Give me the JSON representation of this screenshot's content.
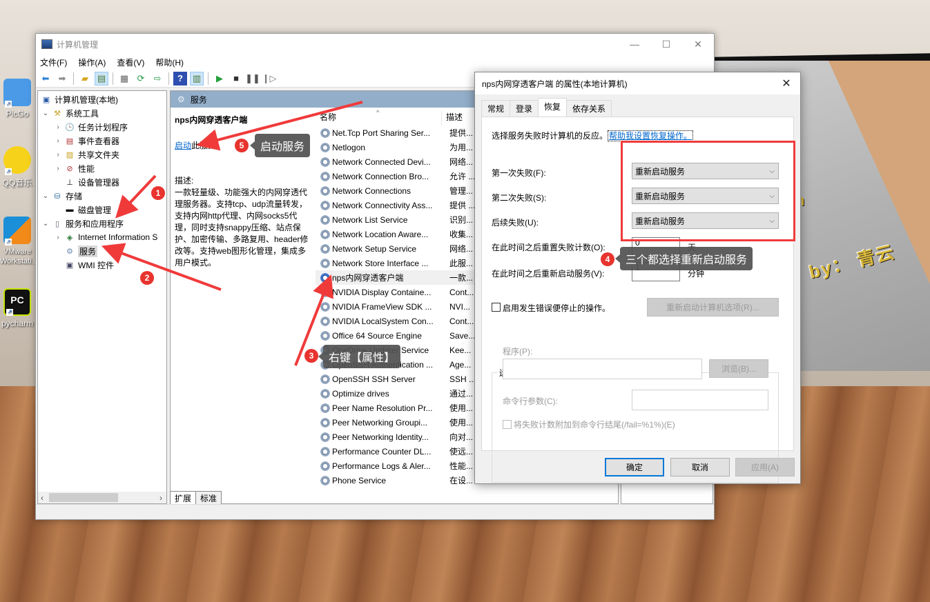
{
  "desktop": {
    "icons": [
      {
        "label": "PicGo",
        "icon": "picgo-icon",
        "color": "#3d8fe6"
      },
      {
        "label": "QQ音乐",
        "icon": "qq-music-icon",
        "color": "#f7d21a"
      },
      {
        "label": "VMware Workstati...",
        "icon": "vmware-icon",
        "color": "#1b8fd8"
      },
      {
        "label": "pycharm",
        "icon": "pycharm-icon",
        "color": "#111111"
      }
    ],
    "wallpaper_text": "by： 青云",
    "wallpaper_letter": "n"
  },
  "mmc": {
    "title": "计算机管理",
    "menu": [
      "文件(F)",
      "操作(A)",
      "查看(V)",
      "帮助(H)"
    ],
    "toolbar": [
      "back-icon",
      "forward-icon",
      "up-folder-icon",
      "show-hide-console-tree-icon",
      "properties-icon",
      "refresh-icon",
      "export-list-icon",
      "help-icon",
      "show-action-pane-icon",
      "start-service-icon",
      "stop-service-icon",
      "pause-service-icon",
      "resume-service-icon"
    ],
    "tree": [
      {
        "label": "计算机管理(本地)",
        "level": 0,
        "chevron": "",
        "icon": "computer-management-icon"
      },
      {
        "label": "系统工具",
        "level": 1,
        "chevron": "⌄",
        "icon": "system-tools-icon"
      },
      {
        "label": "任务计划程序",
        "level": 2,
        "chevron": "›",
        "icon": "task-scheduler-icon"
      },
      {
        "label": "事件查看器",
        "level": 2,
        "chevron": "›",
        "icon": "event-viewer-icon"
      },
      {
        "label": "共享文件夹",
        "level": 2,
        "chevron": "›",
        "icon": "shared-folders-icon"
      },
      {
        "label": "性能",
        "level": 2,
        "chevron": "›",
        "icon": "performance-icon"
      },
      {
        "label": "设备管理器",
        "level": 2,
        "chevron": "",
        "icon": "device-manager-icon"
      },
      {
        "label": "存储",
        "level": 1,
        "chevron": "⌄",
        "icon": "storage-icon"
      },
      {
        "label": "磁盘管理",
        "level": 2,
        "chevron": "",
        "icon": "disk-management-icon"
      },
      {
        "label": "服务和应用程序",
        "level": 1,
        "chevron": "⌄",
        "icon": "services-apps-icon"
      },
      {
        "label": "Internet Information S",
        "level": 2,
        "chevron": "›",
        "icon": "iis-icon"
      },
      {
        "label": "服务",
        "level": 2,
        "chevron": "",
        "icon": "services-icon",
        "selected": true
      },
      {
        "label": "WMI 控件",
        "level": 2,
        "chevron": "",
        "icon": "wmi-icon"
      }
    ],
    "center_header": "服务",
    "detail": {
      "service_name": "nps内网穿透客户端",
      "start_link": "启动",
      "start_suffix": "此服务",
      "desc_label": "描述:",
      "description": "一款轻量级、功能强大的内网穿透代理服务器。支持tcp、udp流量转发，支持内网http代理、内网socks5代理，同时支持snappy压缩、站点保护、加密传输、多路复用、header修改等。支持web图形化管理，集成多用户模式。"
    },
    "list": {
      "columns": [
        "名称",
        "描述"
      ],
      "rows": [
        {
          "name": "Net.Tcp Port Sharing Ser...",
          "desc": "提供..."
        },
        {
          "name": "Netlogon",
          "desc": "为用..."
        },
        {
          "name": "Network Connected Devi...",
          "desc": "网络..."
        },
        {
          "name": "Network Connection Bro...",
          "desc": "允许 ..."
        },
        {
          "name": "Network Connections",
          "desc": "管理..."
        },
        {
          "name": "Network Connectivity Ass...",
          "desc": "提供 ..."
        },
        {
          "name": "Network List Service",
          "desc": "识别..."
        },
        {
          "name": "Network Location Aware...",
          "desc": "收集..."
        },
        {
          "name": "Network Setup Service",
          "desc": "网络..."
        },
        {
          "name": "Network Store Interface ...",
          "desc": "此服..."
        },
        {
          "name": "nps内网穿透客户端",
          "desc": "一款...",
          "highlighted": true
        },
        {
          "name": "NVIDIA Display Containe...",
          "desc": "Cont..."
        },
        {
          "name": "NVIDIA FrameView SDK ...",
          "desc": "NVI..."
        },
        {
          "name": "NVIDIA LocalSystem Con...",
          "desc": "Cont..."
        },
        {
          "name": "Office 64 Source Engine",
          "desc": "Save..."
        },
        {
          "name": "OneDrive Updater Service",
          "desc": "Kee..."
        },
        {
          "name": "OpenSSH Authentication ...",
          "desc": "Age..."
        },
        {
          "name": "OpenSSH SSH Server",
          "desc": "SSH ..."
        },
        {
          "name": "Optimize drives",
          "desc": "通过..."
        },
        {
          "name": "Peer Name Resolution Pr...",
          "desc": "使用..."
        },
        {
          "name": "Peer Networking Groupi...",
          "desc": "使用..."
        },
        {
          "name": "Peer Networking Identity...",
          "desc": "向对..."
        },
        {
          "name": "Performance Counter DL...",
          "desc": "使远..."
        },
        {
          "name": "Performance Logs & Aler...",
          "desc": "性能..."
        },
        {
          "name": "Phone Service",
          "desc": "在设..."
        }
      ]
    },
    "bottom_tabs": [
      "扩展",
      "标准"
    ]
  },
  "dialog": {
    "title": "nps内网穿透客户端 的属性(本地计算机)",
    "tabs": [
      "常规",
      "登录",
      "恢复",
      "依存关系"
    ],
    "active_tab": "恢复",
    "intro": "选择服务失败时计算机的反应。",
    "help_link": "帮助我设置恢复操作。",
    "first_failure_label": "第一次失败(F):",
    "first_failure_value": "重新启动服务",
    "second_failure_label": "第二次失败(S):",
    "second_failure_value": "重新启动服务",
    "subsequent_failure_label": "后续失败(U):",
    "subsequent_failure_value": "重新启动服务",
    "reset_count_label": "在此时间之后重置失败计数(O):",
    "reset_count_value": "0",
    "reset_count_unit": "天",
    "restart_after_label": "在此时间之后重新启动服务(V):",
    "restart_after_value": "1",
    "restart_after_unit": "分钟",
    "stop_on_error_label": "启用发生错误便停止的操作。",
    "stop_on_error_checked": false,
    "restart_computer_button": "重新启动计算机选项(R)...",
    "run_program_group": "运行程序",
    "program_label": "程序(P):",
    "program_value": "",
    "browse_button": "浏览(B)...",
    "cmdline_label": "命令行参数(C):",
    "cmdline_value": "",
    "append_fail_label": "将失败计数附加到命令行结尾(/fail=%1%)(E)",
    "ok_button": "确定",
    "cancel_button": "取消",
    "apply_button": "应用(A)"
  },
  "annotations": [
    {
      "number": "1",
      "text": ""
    },
    {
      "number": "2",
      "text": ""
    },
    {
      "number": "3",
      "text": "右键【属性】"
    },
    {
      "number": "4",
      "text": "三个都选择重新启动服务"
    },
    {
      "number": "5",
      "text": "启动服务"
    }
  ],
  "colors": {
    "annotation_red": "#e8332e",
    "link_blue": "#0066cc",
    "header_blue": "#93aec9"
  }
}
